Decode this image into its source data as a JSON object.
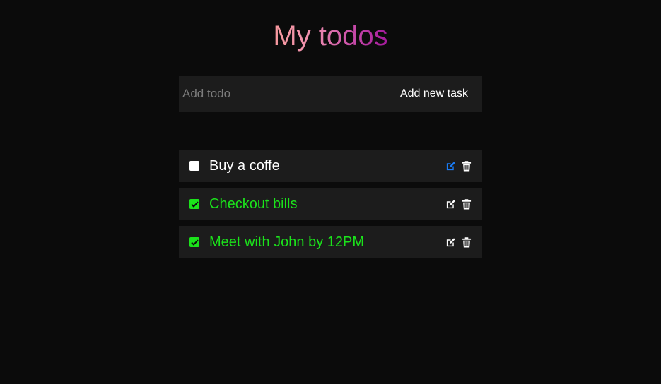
{
  "header": {
    "title": "My todos"
  },
  "add_form": {
    "placeholder": "Add todo",
    "value": "",
    "button_label": "Add new task"
  },
  "todos": [
    {
      "text": "Buy a coffe",
      "completed": false,
      "edit_icon_color": "#1a7cf5"
    },
    {
      "text": "Checkout bills",
      "completed": true,
      "edit_icon_color": "#ffffff"
    },
    {
      "text": "Meet with John by 12PM",
      "completed": true,
      "edit_icon_color": "#ffffff"
    }
  ],
  "colors": {
    "background": "#0b0b0b",
    "panel": "#1c1c1c",
    "done_text": "#1be21b",
    "title_gradient_start": "#f89a9e",
    "title_gradient_end": "#a3189c",
    "edit_active": "#1a7cf5"
  },
  "icons": {
    "edit": "edit-icon",
    "delete": "trash-icon",
    "check": "checkmark-icon"
  }
}
